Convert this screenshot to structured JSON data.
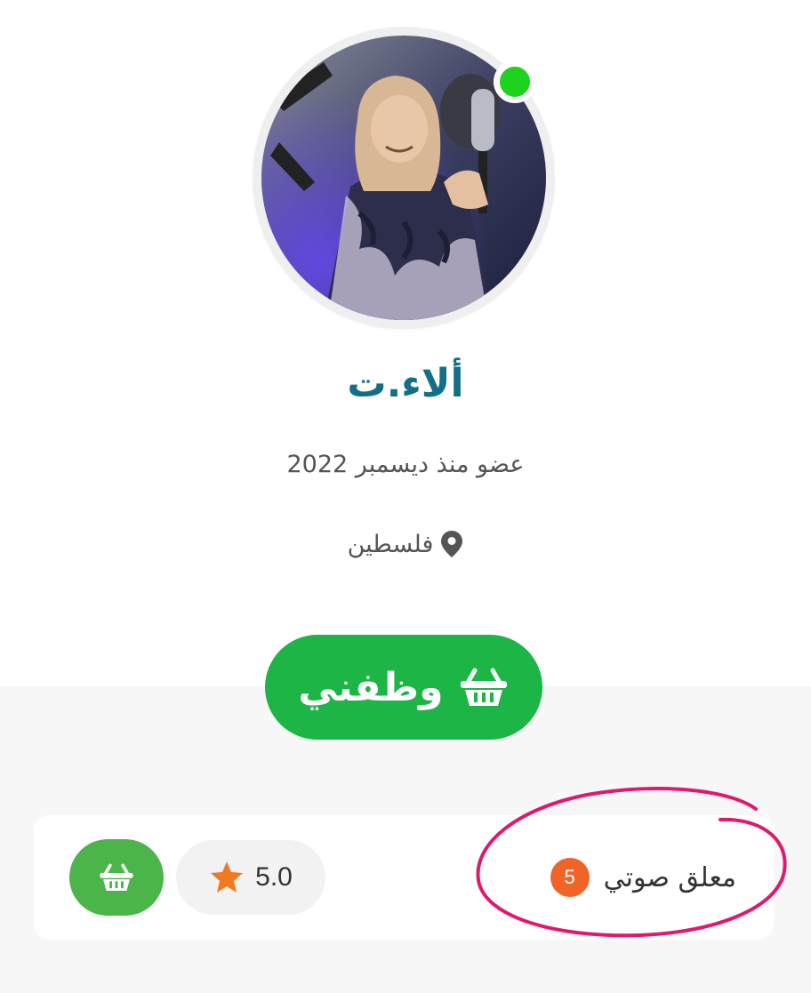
{
  "profile": {
    "name": "ألاء.ت",
    "member_since": "عضو منذ ديسمبر 2022",
    "location": "فلسطين",
    "online": true
  },
  "actions": {
    "hire_label": "وظفني"
  },
  "service": {
    "title": "معلق صوتي",
    "count": "5",
    "rating": "5.0"
  },
  "icons": {
    "location": "location-pin-icon",
    "hire": "shopping-basket-icon",
    "rating": "star-icon",
    "cart": "shopping-basket-icon"
  },
  "colors": {
    "name": "#136f88",
    "online": "#1fd21f",
    "hire_button": "#1db546",
    "badge": "#f06428",
    "star": "#f07a1f",
    "cart_button": "#4bb54a",
    "highlight": "#e0186e"
  }
}
